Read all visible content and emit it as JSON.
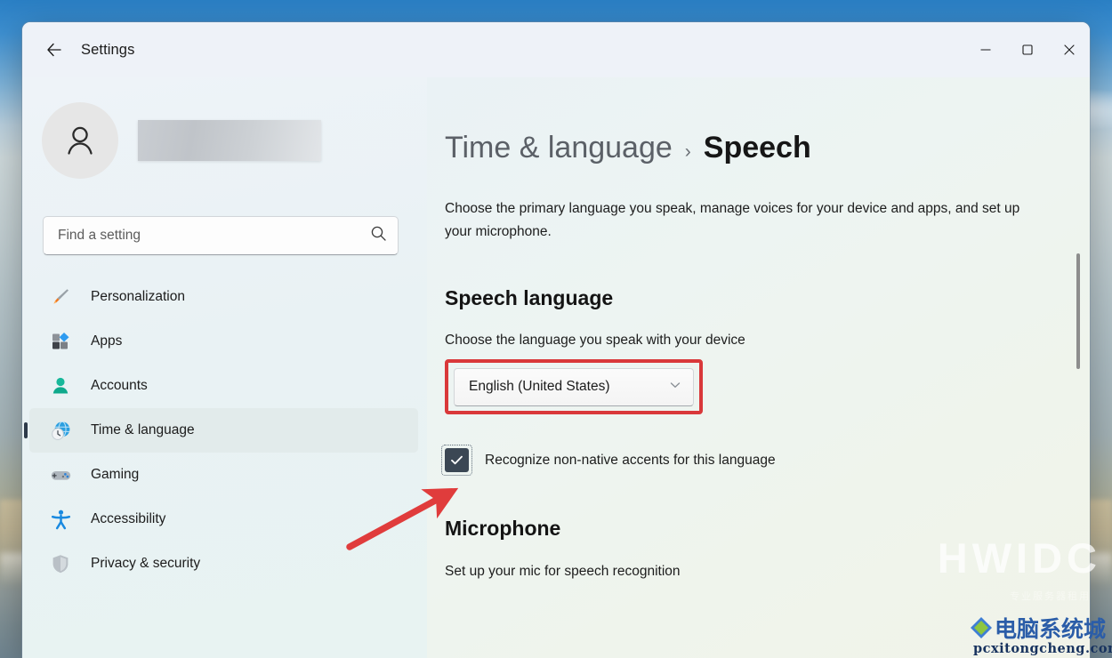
{
  "window": {
    "title": "Settings",
    "back_icon": "back-arrow-icon",
    "controls": {
      "minimize": "minimize-icon",
      "maximize": "maximize-icon",
      "close": "close-icon"
    }
  },
  "sidebar": {
    "account": {
      "avatar_icon": "person-avatar-icon",
      "name_redacted": true
    },
    "search": {
      "placeholder": "Find a setting",
      "value": "",
      "icon": "search-icon"
    },
    "items": [
      {
        "label": "Personalization",
        "icon": "paintbrush-icon",
        "active": false
      },
      {
        "label": "Apps",
        "icon": "apps-grid-icon",
        "active": false
      },
      {
        "label": "Accounts",
        "icon": "person-icon",
        "active": false
      },
      {
        "label": "Time & language",
        "icon": "globe-clock-icon",
        "active": true
      },
      {
        "label": "Gaming",
        "icon": "gamepad-icon",
        "active": false
      },
      {
        "label": "Accessibility",
        "icon": "accessibility-icon",
        "active": false
      },
      {
        "label": "Privacy & security",
        "icon": "shield-icon",
        "active": false
      }
    ]
  },
  "main": {
    "breadcrumb": {
      "parent": "Time & language",
      "separator": "›",
      "current": "Speech"
    },
    "description": "Choose the primary language you speak, manage voices for your device and apps, and set up your microphone.",
    "speech_language": {
      "heading": "Speech language",
      "subtitle": "Choose the language you speak with your device",
      "dropdown": {
        "value": "English (United States)",
        "chevron_icon": "chevron-down-icon",
        "highlighted": true,
        "highlight_color": "#d9383a"
      },
      "accent_checkbox": {
        "label": "Recognize non-native accents for this language",
        "checked": true,
        "check_icon": "checkmark-icon"
      }
    },
    "microphone": {
      "heading": "Microphone",
      "subtitle": "Set up your mic for speech recognition"
    }
  },
  "annotation": {
    "arrow_color": "#e03c3c",
    "points_to": "accent-checkbox"
  },
  "watermarks": {
    "hwidc": "HWIDC",
    "hwidc_sub": "专业服务器租用",
    "site_cn": "电脑系统城",
    "site_url": "pcxitongcheng.com"
  },
  "colors": {
    "accent_red": "#d9383a",
    "checkbox_fill": "#3b4754",
    "nav_active_bg": "#e2eaea",
    "sidebar_bg": "#eef3f8",
    "content_bg": "#eef4f1"
  }
}
